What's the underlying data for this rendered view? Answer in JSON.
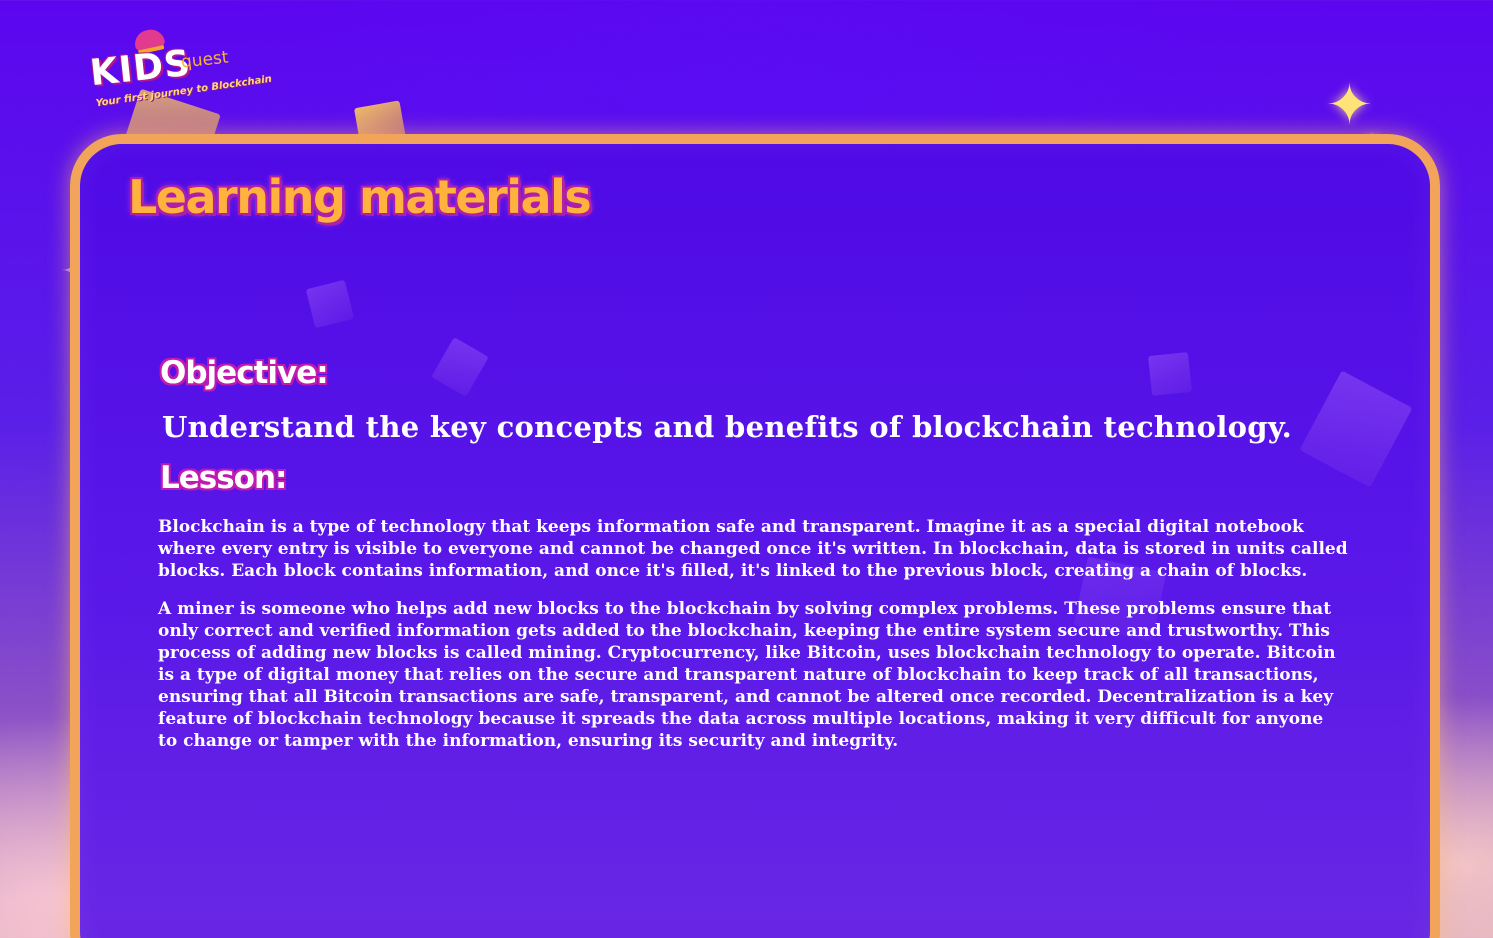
{
  "app": {
    "logo": {
      "brand_main": "KIDS",
      "brand_sub": "quest",
      "tagline": "Your first journey to Blockchain"
    }
  },
  "page": {
    "title": "Learning materials"
  },
  "objective": {
    "heading": "Objective:",
    "text": "Understand the key concepts and benefits of blockchain technology."
  },
  "lesson": {
    "heading": "Lesson:",
    "paragraphs": [
      "Blockchain is a type of technology that keeps information safe and transparent. Imagine it as a special digital notebook where every entry is visible to everyone and cannot be changed once it's written. In blockchain, data is stored in units called blocks. Each block contains information, and once it's filled, it's linked to the previous block, creating a chain of blocks.",
      "A miner is someone who helps add new blocks to the blockchain by solving complex problems. These problems ensure that only correct and verified information gets added to the blockchain, keeping the entire system secure and trustworthy. This process of adding new blocks is called mining. Cryptocurrency, like Bitcoin, uses blockchain technology to operate. Bitcoin is a type of digital money that relies on the secure and transparent nature of blockchain to keep track of all transactions, ensuring that all Bitcoin transactions are safe, transparent, and cannot be altered once recorded. Decentralization is a key feature of blockchain technology because it spreads the data across multiple locations, making it very difficult for anyone to change or tamper with the information, ensuring its security and integrity."
    ]
  },
  "theme": {
    "background": "#5b06ef",
    "card_border": "#f2a55a",
    "title_color": "#ffb23e",
    "heading_outline": "#c11ab0"
  },
  "icons": [
    "sparkle-icon",
    "block-shard-icon",
    "hat-icon"
  ]
}
